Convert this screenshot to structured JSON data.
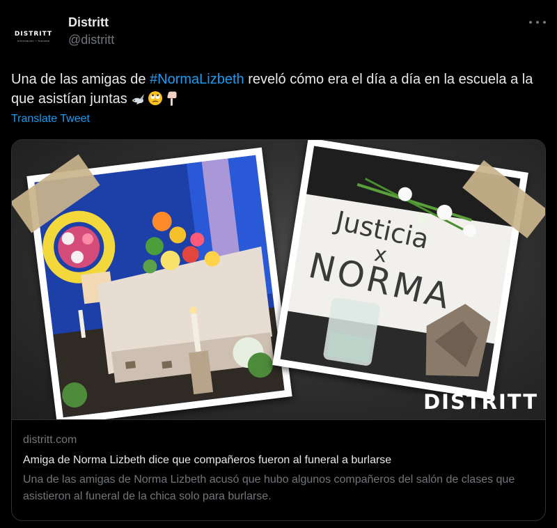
{
  "author": {
    "display_name": "Distritt",
    "handle": "@distritt",
    "avatar_logo": "DISTRITT",
    "avatar_tagline": "Información + Noticias"
  },
  "tweet": {
    "text_before": "Una de las amigas de ",
    "hashtag": "#NormaLizbeth",
    "text_after": " reveló cómo era el día a día en la escuela a la que asistían juntas",
    "emojis": [
      "dove-icon",
      "rolling-eyes-face-icon",
      "backhand-index-pointing-down-icon"
    ],
    "translate_label": "Translate Tweet"
  },
  "card": {
    "domain": "distritt.com",
    "title": "Amiga de Norma Lizbeth dice que compañeros fueron al funeral a burlarse",
    "description": "Una de las amigas de Norma Lizbeth acusó que hubo algunos compañeros del salón de clases que asistieron al funeral de la chica solo para burlarse.",
    "image": {
      "brand_watermark": "DISTRITT",
      "sign_line1": "Justicia",
      "sign_line2": "x",
      "sign_line3": "NORMA"
    }
  },
  "colors": {
    "background": "#000000",
    "text_primary": "#e7e9ea",
    "text_secondary": "#71767b",
    "link": "#1d9bf0",
    "border": "#2f3336"
  }
}
